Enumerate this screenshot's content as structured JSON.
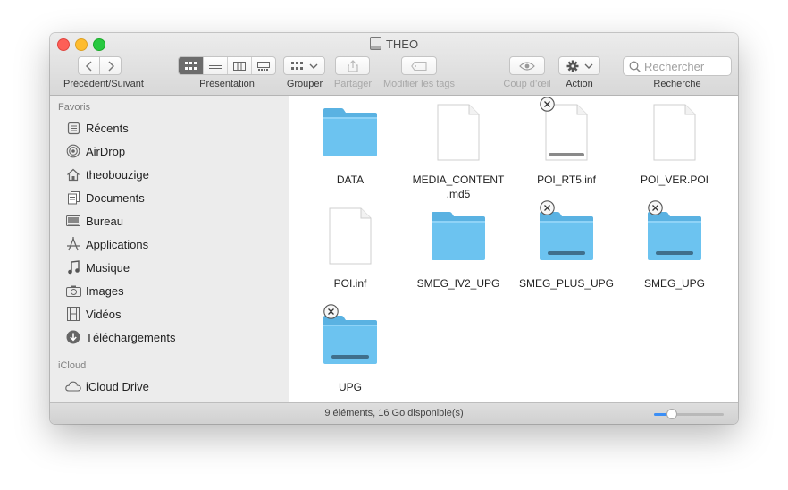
{
  "window": {
    "title": "THEO"
  },
  "toolbar": {
    "nav_label": "Précédent/Suivant",
    "view_label": "Présentation",
    "group_label": "Grouper",
    "share_label": "Partager",
    "tags_label": "Modifier les tags",
    "quicklook_label": "Coup d’œil",
    "action_label": "Action",
    "search_label": "Recherche",
    "search_placeholder": "Rechercher"
  },
  "sidebar": {
    "favorites_header": "Favoris",
    "favorites": [
      {
        "label": "Récents",
        "icon": "recents-icon"
      },
      {
        "label": "AirDrop",
        "icon": "airdrop-icon"
      },
      {
        "label": "theobouzige",
        "icon": "home-icon"
      },
      {
        "label": "Documents",
        "icon": "documents-icon"
      },
      {
        "label": "Bureau",
        "icon": "desktop-icon"
      },
      {
        "label": "Applications",
        "icon": "applications-icon"
      },
      {
        "label": "Musique",
        "icon": "music-icon"
      },
      {
        "label": "Images",
        "icon": "camera-icon"
      },
      {
        "label": "Vidéos",
        "icon": "film-icon"
      },
      {
        "label": "Téléchargements",
        "icon": "downloads-icon"
      }
    ],
    "icloud_header": "iCloud",
    "icloud": [
      {
        "label": "iCloud Drive",
        "icon": "cloud-icon"
      }
    ]
  },
  "files": [
    {
      "name": "DATA",
      "kind": "folder",
      "badge": false,
      "bar": false
    },
    {
      "name": "MEDIA_CONTENT\n.md5",
      "kind": "document",
      "badge": false,
      "bar": false
    },
    {
      "name": "POI_RT5.inf",
      "kind": "document",
      "badge": true,
      "bar": true
    },
    {
      "name": "POI_VER.POI",
      "kind": "document",
      "badge": false,
      "bar": false
    },
    {
      "name": "POI.inf",
      "kind": "document",
      "badge": false,
      "bar": false
    },
    {
      "name": "SMEG_IV2_UPG",
      "kind": "folder",
      "badge": false,
      "bar": false
    },
    {
      "name": "SMEG_PLUS_UPG",
      "kind": "folder",
      "badge": true,
      "bar": true
    },
    {
      "name": "SMEG_UPG",
      "kind": "folder",
      "badge": true,
      "bar": true
    },
    {
      "name": "UPG",
      "kind": "folder",
      "badge": true,
      "bar": true
    }
  ],
  "status": {
    "text": "9 éléments, 16 Go disponible(s)",
    "zoom_level": 0.25
  },
  "colors": {
    "folder": "#6cc3f0",
    "folder_tab": "#5ab2e2",
    "accent": "#3c8ff6"
  }
}
